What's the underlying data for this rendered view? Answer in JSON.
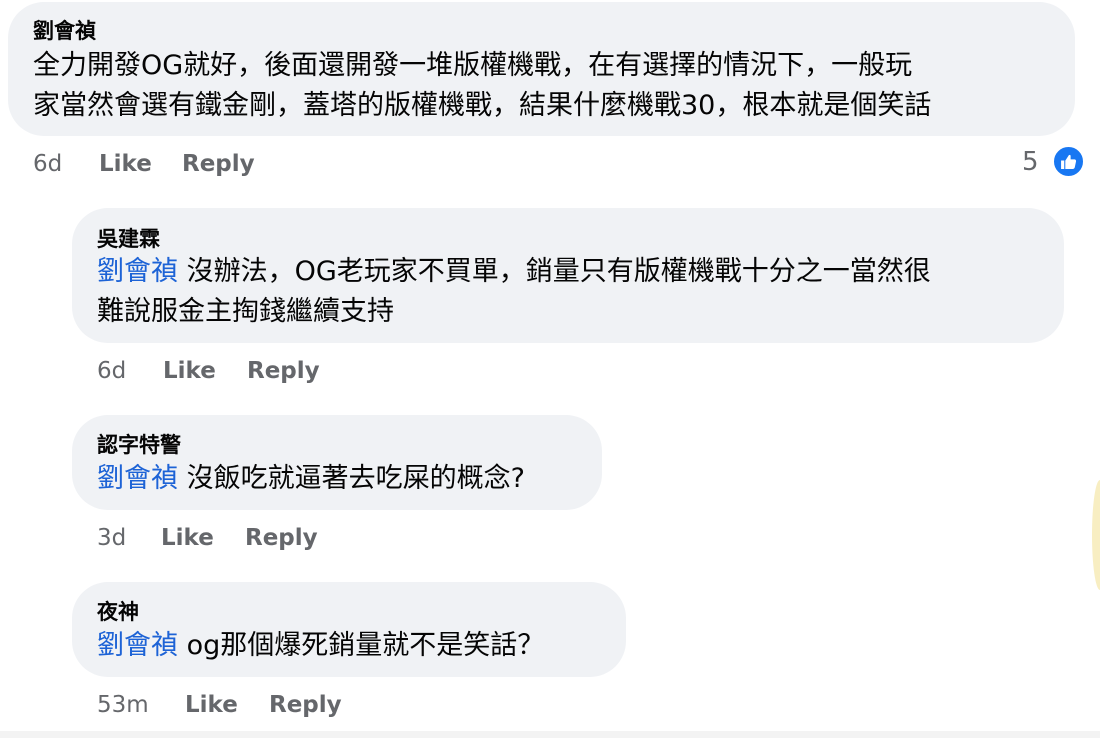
{
  "comments": [
    {
      "author": "劉會禎",
      "line1": "全力開發OG就好，後面還開發一堆版權機戰，在有選擇的情況下，一般玩",
      "line2": "家當然會選有鐵金剛，蓋塔的版權機戰，結果什麼機戰30，根本就是個笑話",
      "time": "6d",
      "like_label": "Like",
      "reply_label": "Reply",
      "reaction_count": "5"
    },
    {
      "author": "吳建霖",
      "mention": "劉會禎",
      "line1": " 沒辦法，OG老玩家不買單，銷量只有版權機戰十分之一當然很",
      "line2": "難說服金主掏錢繼續支持",
      "time": "6d",
      "like_label": "Like",
      "reply_label": "Reply"
    },
    {
      "author": "認字特警",
      "mention": "劉會禎",
      "line1": " 沒飯吃就逼著去吃屎的概念?",
      "time": "3d",
      "like_label": "Like",
      "reply_label": "Reply"
    },
    {
      "author": "夜神",
      "mention": "劉會禎",
      "line1": " og那個爆死銷量就不是笑話？",
      "time": "53m",
      "like_label": "Like",
      "reply_label": "Reply"
    }
  ],
  "colors": {
    "bubble": "#f0f2f5",
    "mention": "#1d63d6",
    "meta": "#65676b",
    "like_badge": "#1877f2"
  },
  "icons": {
    "reaction": "thumbs-up-icon"
  }
}
